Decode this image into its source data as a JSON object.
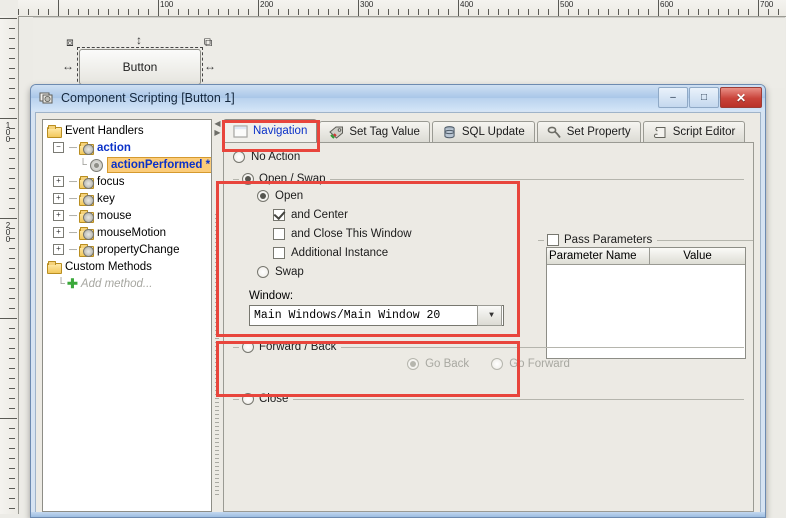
{
  "designer": {
    "ruler_h_labels": [
      "100",
      "200",
      "300",
      "400",
      "500",
      "600",
      "700"
    ],
    "ruler_v_labels": [
      "100",
      "200"
    ],
    "selected_component": {
      "label": "Button",
      "handle_icon": "resize-handle-icon"
    }
  },
  "dialog": {
    "title": "Component Scripting [Button 1]",
    "title_icon": "script-icon",
    "window_buttons": {
      "minimize": "–",
      "maximize": "□",
      "close": "✕"
    }
  },
  "tree": {
    "root": "Event Handlers",
    "nodes": [
      {
        "label": "action",
        "expander": "−",
        "style": "blue"
      },
      {
        "label": "actionPerformed *",
        "style": "selected"
      },
      {
        "label": "focus",
        "expander": "+"
      },
      {
        "label": "key",
        "expander": "+"
      },
      {
        "label": "mouse",
        "expander": "+"
      },
      {
        "label": "mouseMotion",
        "expander": "+"
      },
      {
        "label": "propertyChange",
        "expander": "+"
      }
    ],
    "custom_methods": "Custom Methods",
    "add_method": "Add method..."
  },
  "tabs": [
    {
      "label": "Navigation",
      "icon": "window-icon",
      "active": true
    },
    {
      "label": "Set Tag Value",
      "icon": "tag-icon",
      "active": false
    },
    {
      "label": "SQL Update",
      "icon": "database-icon",
      "active": false
    },
    {
      "label": "Set Property",
      "icon": "property-icon",
      "active": false
    },
    {
      "label": "Script Editor",
      "icon": "script-editor-icon",
      "active": false
    }
  ],
  "navigation": {
    "no_action": {
      "label": "No Action",
      "selected": false
    },
    "open_swap": {
      "label": "Open / Swap",
      "selected": true,
      "open": {
        "label": "Open",
        "selected": true
      },
      "and_center": {
        "label": "and Center",
        "checked": true
      },
      "and_close": {
        "label": "and Close This Window",
        "checked": false
      },
      "additional_instance": {
        "label": "Additional Instance",
        "checked": false
      },
      "swap": {
        "label": "Swap",
        "selected": false
      }
    },
    "window": {
      "label": "Window:",
      "value": "Main Windows/Main Window 20",
      "arrow": "▼"
    },
    "pass_parameters": {
      "label": "Pass Parameters",
      "checked": false,
      "columns": [
        "Parameter Name",
        "Value"
      ],
      "rows": [],
      "buttons": [
        "add-parameter",
        "delete-parameter",
        "edit-parameter"
      ]
    },
    "forward_back": {
      "label": "Forward / Back",
      "selected": false,
      "go_back": {
        "label": "Go Back",
        "selected": true,
        "disabled": true
      },
      "go_forward": {
        "label": "Go Forward",
        "selected": false,
        "disabled": true
      }
    },
    "close": {
      "label": "Close",
      "selected": false
    }
  },
  "colors": {
    "accent_link": "#0a31c8",
    "highlight_box": "#e8453c",
    "selection_bg": "#fbcc7a",
    "titlebar": "#a8c6e8",
    "close_button": "#c9433a"
  }
}
